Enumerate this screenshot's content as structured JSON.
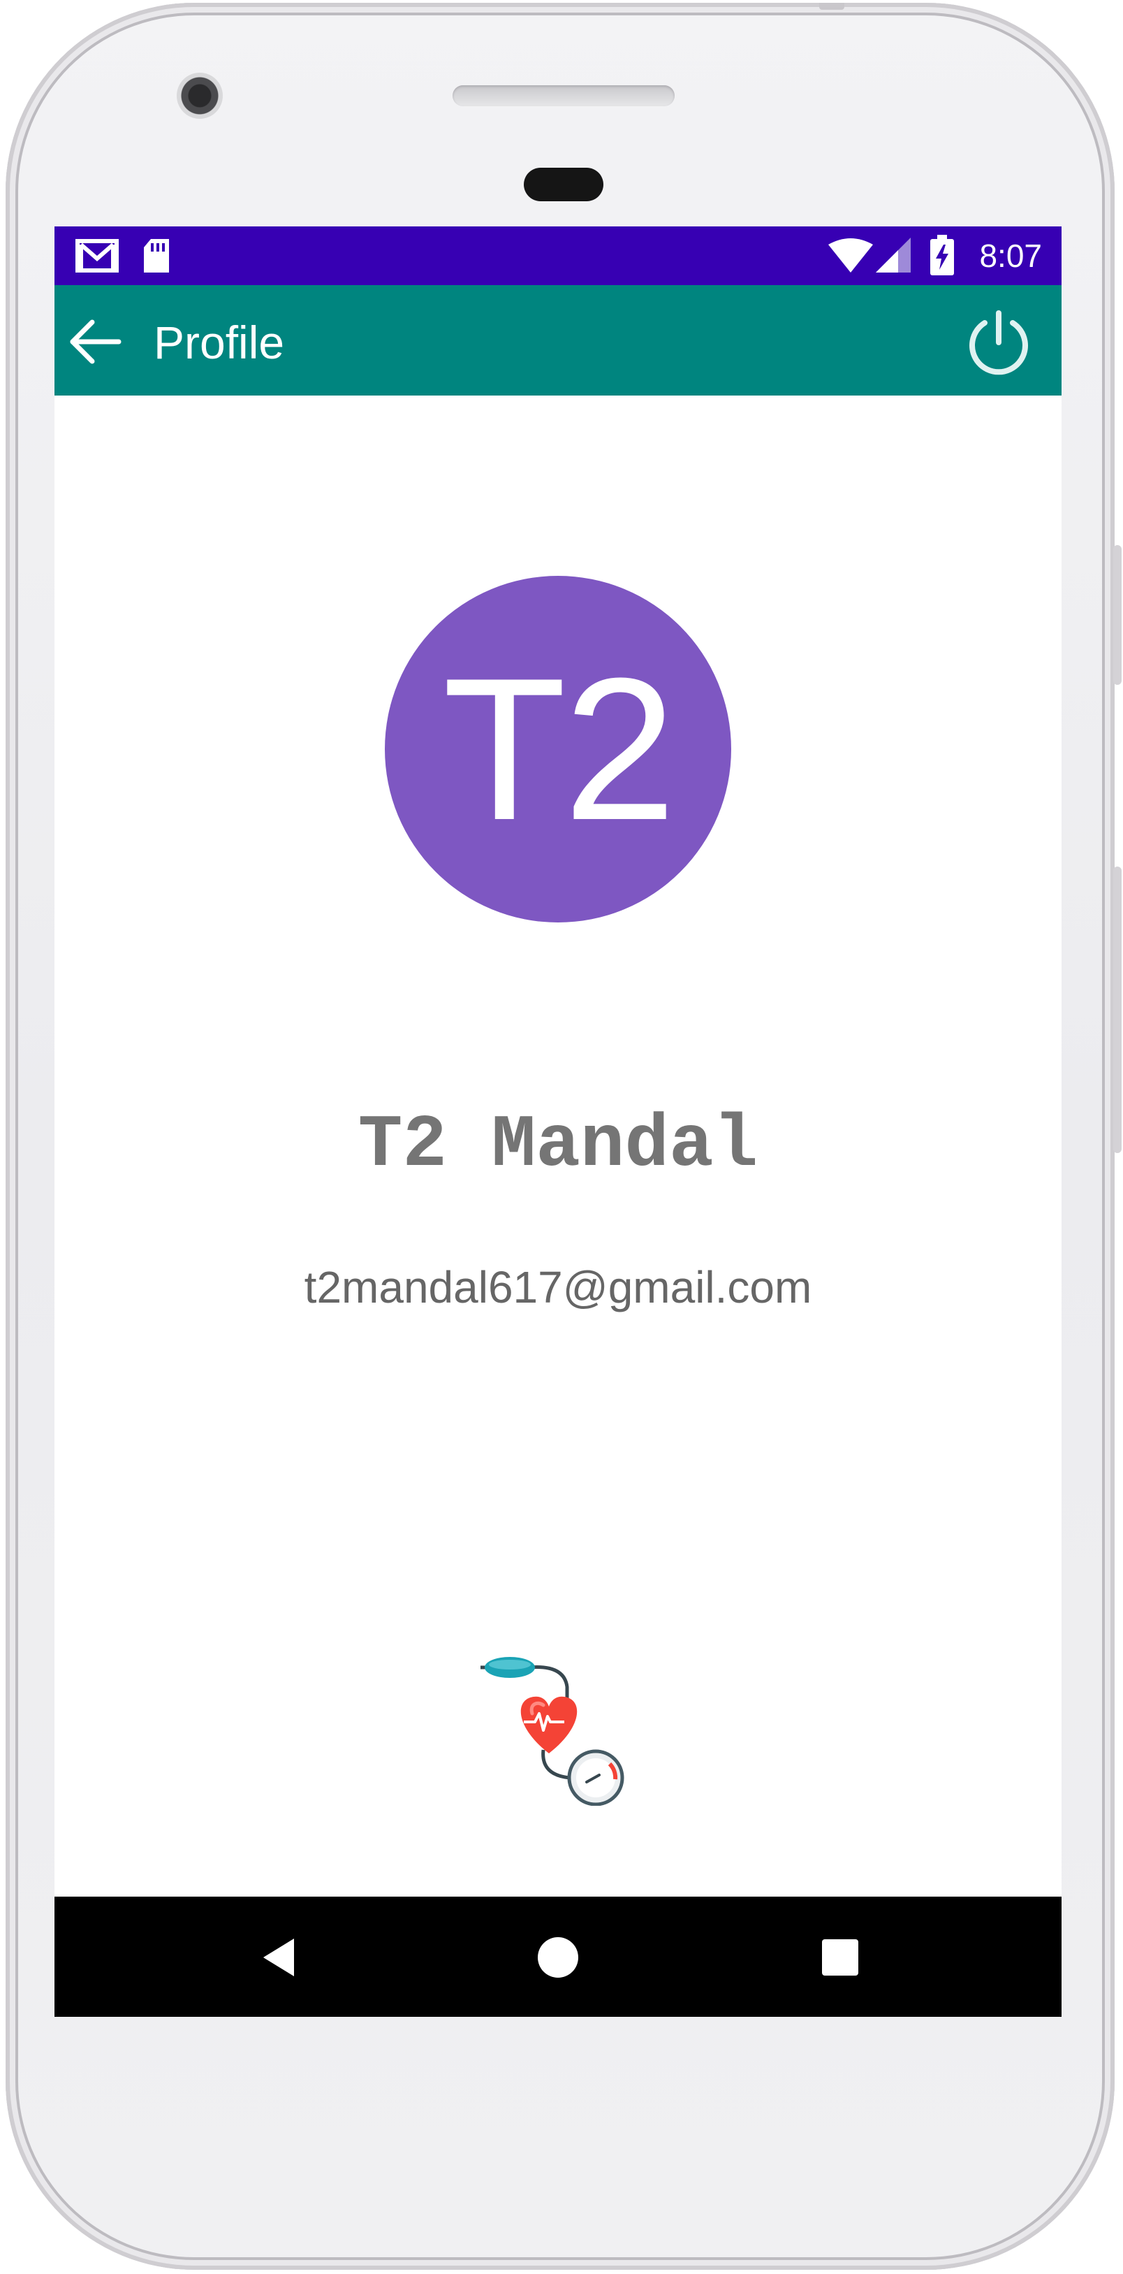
{
  "status_bar": {
    "time": "8:07",
    "icons": [
      "gmail-icon",
      "sd-card-icon",
      "wifi-icon",
      "cell-signal-icon",
      "battery-charging-icon"
    ],
    "color": "#3700b3"
  },
  "app_bar": {
    "title": "Profile",
    "back_icon": "arrow-left-icon",
    "logout_icon": "power-icon",
    "color": "#00857f"
  },
  "profile": {
    "avatar_initials": "T2",
    "avatar_color": "#7e57c2",
    "name": "T2 Mandal",
    "email": "t2mandal617@gmail.com"
  },
  "app_logo": {
    "icon": "blood-pressure-heart-icon"
  },
  "nav_bar": {
    "buttons": [
      "back-triangle-icon",
      "home-circle-icon",
      "recents-square-icon"
    ]
  }
}
